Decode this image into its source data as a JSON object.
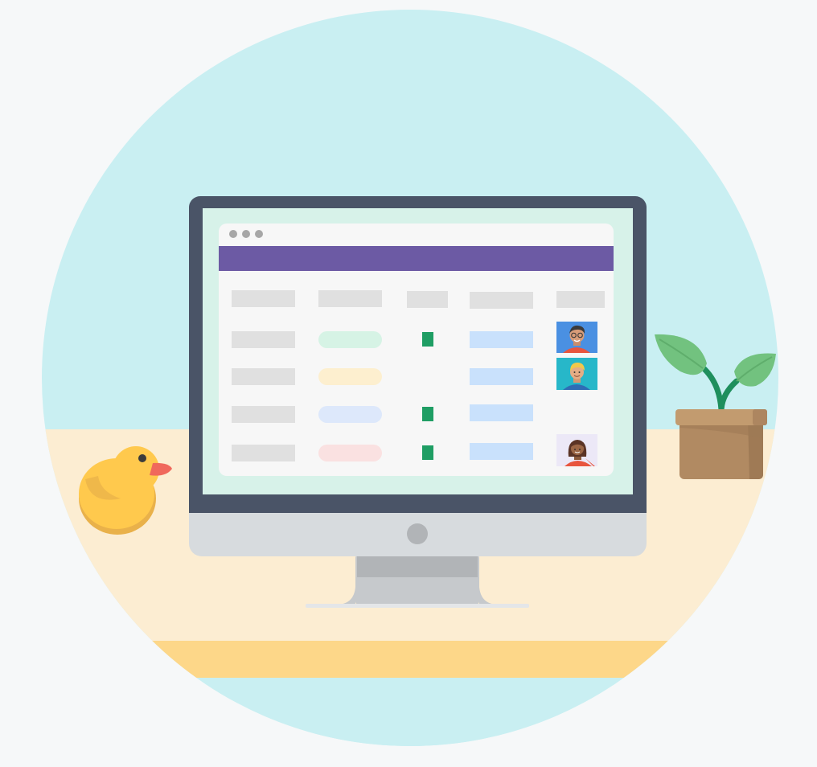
{
  "palette": {
    "page_background": "#f6f8f9",
    "sky": "#c9eff2",
    "desk_surface": "#fcedd2",
    "desk_edge": "#fdd789",
    "monitor_bezel": "#4a5467",
    "monitor_chin": "#d7dbde",
    "monitor_stand": "#c6c9cc",
    "monitor_stand_top": "#b1b4b7",
    "screen_background": "#d7f2e9",
    "window_background": "#f7f7f7",
    "window_header": "#6c5aa4",
    "window_dots": "#a7a7a7",
    "placeholder_gray": "#e0e0e0",
    "placeholder_blue": "#c9e1fc",
    "status_square": "#1f9e64",
    "duck_body": "#ffc94d",
    "duck_shadow": "#e9b14a",
    "duck_beak": "#f0685c",
    "pot": "#b18a62",
    "pot_rim": "#c29b6f",
    "leaf": "#72c27f",
    "stem": "#1f8f5d"
  },
  "illustration": {
    "subject": "desktop-monitor-showing-table-app",
    "props": [
      "rubber-duck-icon",
      "potted-plant-icon"
    ]
  },
  "table": {
    "column_count": 5,
    "row_count": 4,
    "rows": [
      {
        "pill_color": "#d6f3e5",
        "has_status": true,
        "avatar": "avatar-man-glasses-icon"
      },
      {
        "pill_color": "#fdefcf",
        "has_status": false,
        "avatar": "avatar-man-blond-icon"
      },
      {
        "pill_color": "#dde8fb",
        "has_status": true,
        "avatar": ""
      },
      {
        "pill_color": "#fae1e1",
        "has_status": true,
        "avatar": "avatar-woman-icon"
      }
    ]
  }
}
